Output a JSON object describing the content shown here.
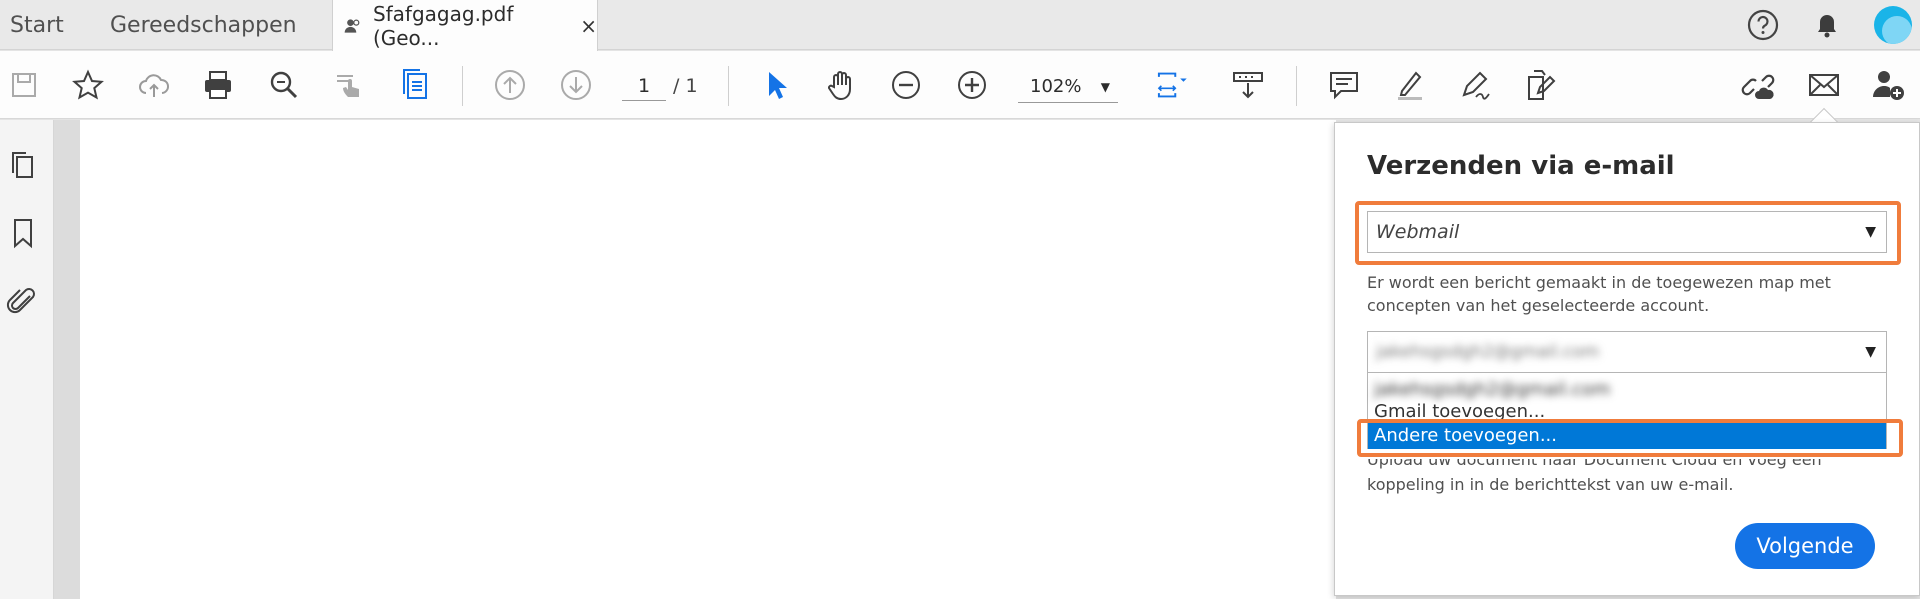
{
  "tabs": {
    "start": "Start",
    "tools": "Gereedschappen",
    "document": "Sfafgagag.pdf (Geo...",
    "close": "×"
  },
  "topright": {
    "help_icon": "help-icon",
    "bell_icon": "bell-icon",
    "avatar_color": "#1ab4e8"
  },
  "toolbar": {
    "page_current": "1",
    "page_total": "/ 1",
    "zoom": "102%"
  },
  "panel": {
    "title": "Verzenden via e-mail",
    "email_client_selected": "Webmail",
    "description_1": "Er wordt een bericht gemaakt in de toegewezen map met concepten van het geselecteerde account.",
    "account_selected": "jakehsgsdgh2@gmail.com",
    "options": [
      "jakehsgsdgh2@gmail.com",
      "Gmail toevoegen...",
      "Andere toevoegen..."
    ],
    "description_2_line1": "Upload uw document naar Document Cloud en voeg een",
    "description_2_line2": "koppeling in in de berichttekst van uw e-mail.",
    "next_button": "Volgende"
  },
  "colors": {
    "accent_blue": "#1473e6",
    "selected_option": "#0078d7",
    "highlight_orange": "#f07c3c",
    "cursor_blue": "#1473e6"
  }
}
